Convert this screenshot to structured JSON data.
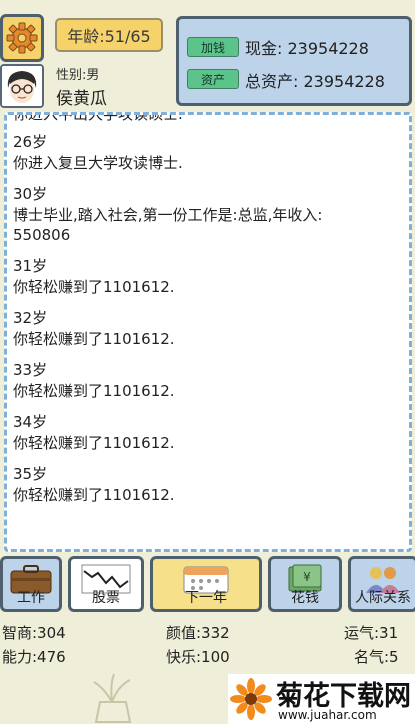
{
  "header": {
    "age_label": "年龄:51/65",
    "gender": "性别:男",
    "name": "侯黄瓜",
    "cash_tag": "加钱",
    "cash_text": "现金: 23954228",
    "assets_tag": "资产",
    "assets_text": "总资产: 23954228"
  },
  "log": {
    "partial_line": "你进入中山大学攻读硕士.",
    "entries": [
      {
        "age": "26岁",
        "text": "你进入复旦大学攻读博士."
      },
      {
        "age": "30岁",
        "text": "博士毕业,踏入社会,第一份工作是:总监,年收入:\n550806"
      },
      {
        "age": "31岁",
        "text": "你轻松赚到了1101612."
      },
      {
        "age": "32岁",
        "text": "你轻松赚到了1101612."
      },
      {
        "age": "33岁",
        "text": "你轻松赚到了1101612."
      },
      {
        "age": "34岁",
        "text": "你轻松赚到了1101612."
      },
      {
        "age": "35岁",
        "text": "你轻松赚到了1101612."
      }
    ]
  },
  "actions": {
    "work": "工作",
    "stocks": "股票",
    "next_year": "下一年",
    "spend": "花钱",
    "relations": "人际关系"
  },
  "stats": {
    "iq": "智商:304",
    "looks": "颜值:332",
    "luck": "运气:31",
    "ability": "能力:476",
    "happiness": "快乐:100",
    "fame": "名气:5"
  },
  "watermark": {
    "title": "菊花下载网",
    "url": "www.juahar.com"
  },
  "colors": {
    "background": "#efeed8",
    "panel_blue": "#bcd3ea",
    "tag_green": "#5cc48a",
    "accent_yellow": "#f6d36a",
    "dashed_border": "#7fb0d9"
  }
}
